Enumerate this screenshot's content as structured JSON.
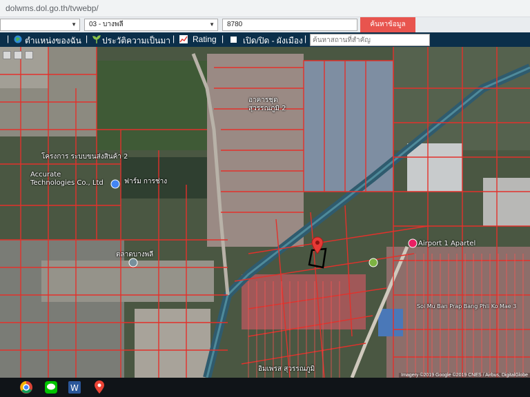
{
  "browser": {
    "url": "dolwms.dol.go.th/tvwebp/"
  },
  "search": {
    "district": "03 - บางพลี",
    "parcel_no": "8780",
    "button_label": "ค้นหาข้อมูล",
    "place_placeholder": "ค้นหาสถานที่สำคัญ"
  },
  "toolbar": {
    "my_location": "ตำแหน่งของฉัน",
    "satisfaction": "ประวัติความเป็นมา",
    "rating": "Rating",
    "toggle_layer": "เปิด/ปิด - ผังเมือง"
  },
  "map": {
    "labels": {
      "building": "อาคารชุด",
      "village": "สุวรรณภูมิ 2",
      "accurate": "Accurate",
      "tech": "Technologies Co., Ltd",
      "warehouse": "โครงการ ระบบขนส่งสินค้า 2",
      "pharmacy": "ฟาร์ม การช่าง",
      "airport": "Airport 1 Apartel",
      "soi": "Soi Mu Ban Prap Bang Phli Ko Mae 3",
      "market": "ตลาดบางพลี",
      "shopping": "อิมเพรส สุวรรณภูมิ"
    },
    "credit": "Imagery ©2019 Google ©2019 CNES / Airbus, DigitalGlobe"
  },
  "taskbar": {
    "apps": [
      "chrome-icon",
      "line-icon",
      "word-icon",
      "maps-icon"
    ]
  },
  "colors": {
    "parcel_line": "#e3312b",
    "marker": "#e53935",
    "toolbar_bg": "#0b2f4a",
    "search_button": "#e8544e"
  }
}
